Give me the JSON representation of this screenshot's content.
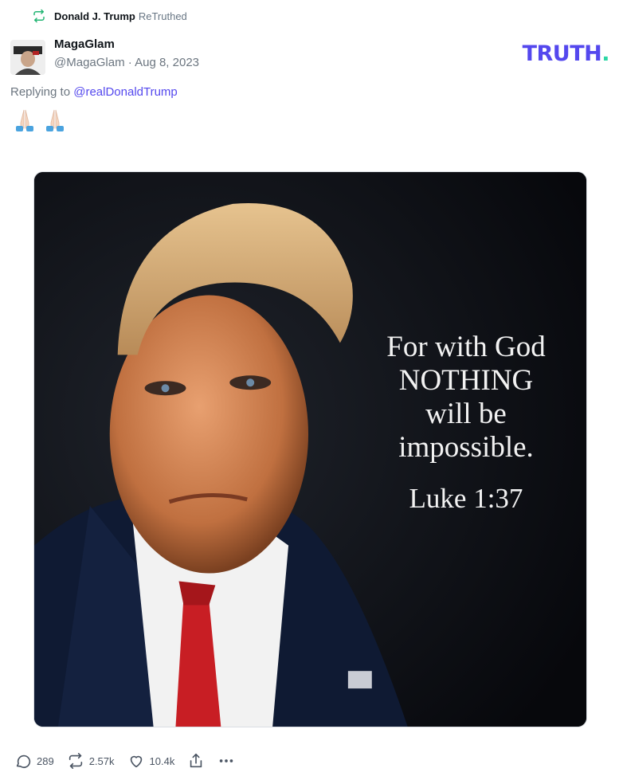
{
  "retruth": {
    "icon": "retruth-icon",
    "user": "Donald J. Trump",
    "label": "ReTruthed"
  },
  "post": {
    "display_name": "MagaGlam",
    "handle": "@MagaGlam",
    "separator": "·",
    "date": "Aug 8, 2023",
    "replying_prefix": "Replying to",
    "replying_to": "@realDonaldTrump",
    "emojis": [
      "folded-hands-icon",
      "folded-hands-icon"
    ]
  },
  "brand": {
    "logo_text": "TRUTH",
    "logo_dot": ".",
    "accent_color": "#5448ee",
    "dot_color": "#2cd6a5"
  },
  "media": {
    "quote_lines": [
      "For with God",
      "NOTHING",
      "will be",
      "impossible."
    ],
    "citation": "Luke 1:37"
  },
  "actions": {
    "replies": "289",
    "retruths": "2.57k",
    "likes": "10.4k"
  }
}
